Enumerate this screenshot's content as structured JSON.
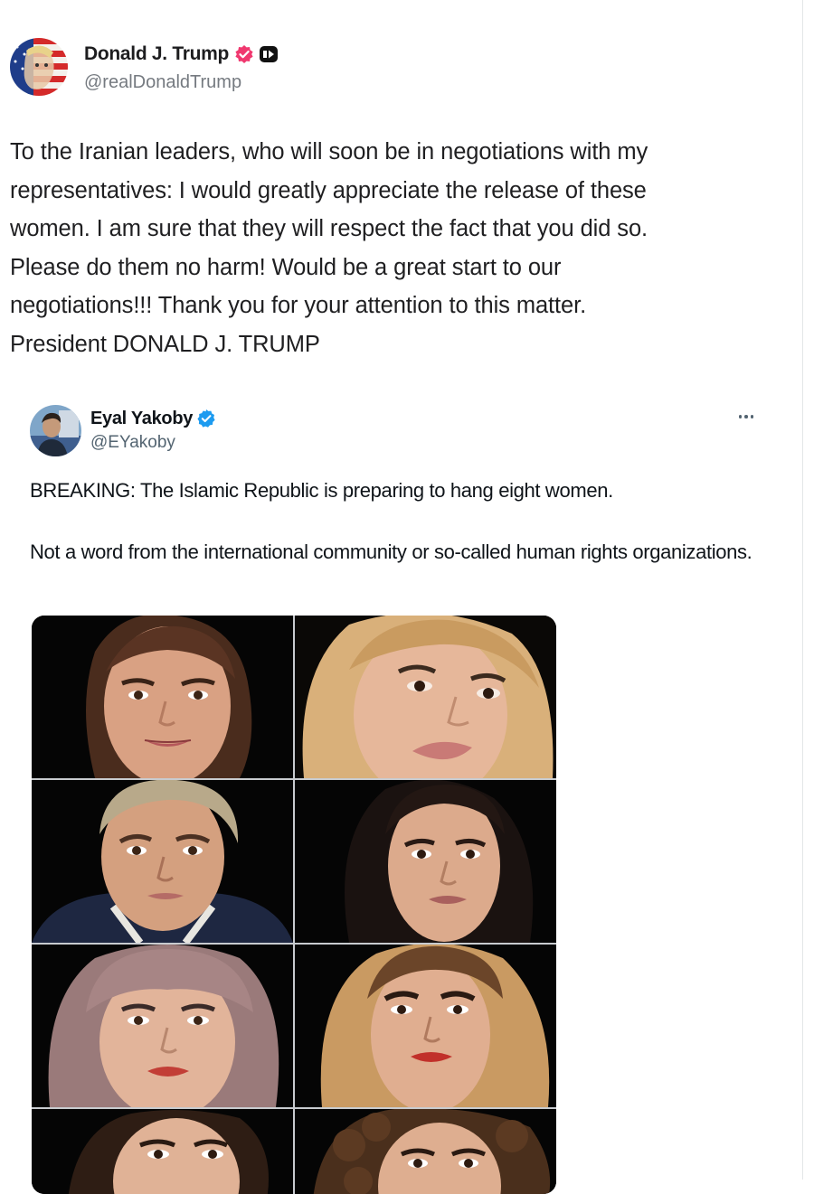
{
  "post": {
    "author_name": "Donald J. Trump",
    "author_handle": "@realDonaldTrump",
    "verified_icon": "verified-badge-icon",
    "badge_icon": "bot-badge-icon",
    "text": "To the Iranian leaders, who will soon be in negotiations with my\nrepresentatives: I would greatly appreciate the release of these\nwomen. I am sure that they will respect the fact that you did so.\nPlease do them no harm! Would be a great start to our\nnegotiations!!! Thank you for your attention to this matter.\nPresident DONALD J. TRUMP"
  },
  "quoted_post": {
    "author_name": "Eyal Yakoby",
    "author_handle": "@EYakoby",
    "verified_icon": "blue-check-icon",
    "more_icon": "more-horizontal-icon",
    "text_line1": "BREAKING: The Islamic Republic is preparing to hang eight women.",
    "text_line2": "Not a word from the international community or so-called human rights organizations.",
    "photo_count": 8
  },
  "colors": {
    "truth_verified": "#f0386f",
    "x_verified": "#1d9bf0",
    "handle_gray": "#757a80",
    "photo_background": "#050505"
  }
}
